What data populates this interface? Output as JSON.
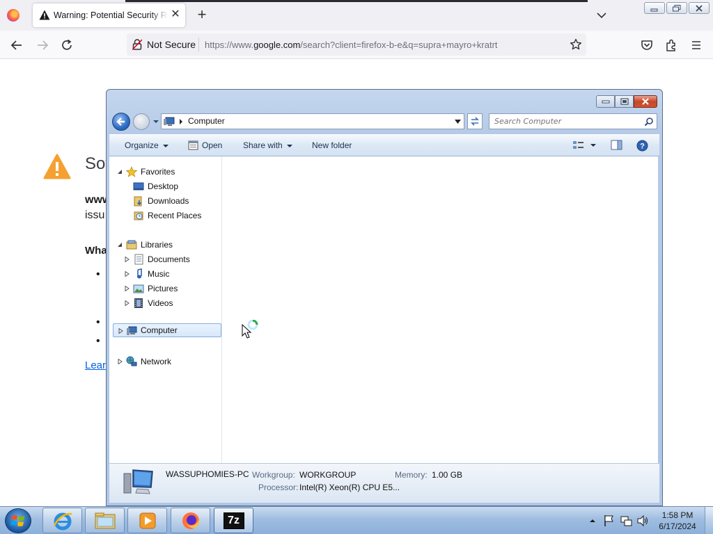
{
  "browser": {
    "tab_title": "Warning: Potential Security Risk Ahead",
    "url_security_label": "Not Secure",
    "url_prefix": "https://www.",
    "url_host": "google.com",
    "url_rest": "/search?client=firefox-b-e&q=supra+mayro+kratrt"
  },
  "page": {
    "title_partial": "Sof",
    "bold_partial": "www",
    "line_partial": "issu",
    "heading_partial": "Wha",
    "bullet": "•",
    "learn_partial": "Lear"
  },
  "explorer": {
    "breadcrumb": "Computer",
    "search_placeholder": "Search Computer",
    "commands": {
      "organize": "Organize",
      "open": "Open",
      "share_with": "Share with",
      "new_folder": "New folder"
    },
    "nav": {
      "favorites": "Favorites",
      "desktop": "Desktop",
      "downloads": "Downloads",
      "recent_places": "Recent Places",
      "libraries": "Libraries",
      "documents": "Documents",
      "music": "Music",
      "pictures": "Pictures",
      "videos": "Videos",
      "computer": "Computer",
      "network": "Network"
    },
    "details": {
      "pc_name": "WASSUPHOMIES-PC",
      "workgroup_label": "Workgroup:",
      "workgroup_value": "WORKGROUP",
      "memory_label": "Memory:",
      "memory_value": "1.00 GB",
      "processor_label": "Processor:",
      "processor_value": "Intel(R) Xeon(R) CPU E5..."
    }
  },
  "taskbar": {
    "time": "1:58 PM",
    "date": "6/17/2024",
    "app_7zip": "7z"
  },
  "colors": {
    "accent_blue": "#2c6cc7",
    "warning_orange": "#f6a031",
    "link_blue": "#0061e0"
  }
}
